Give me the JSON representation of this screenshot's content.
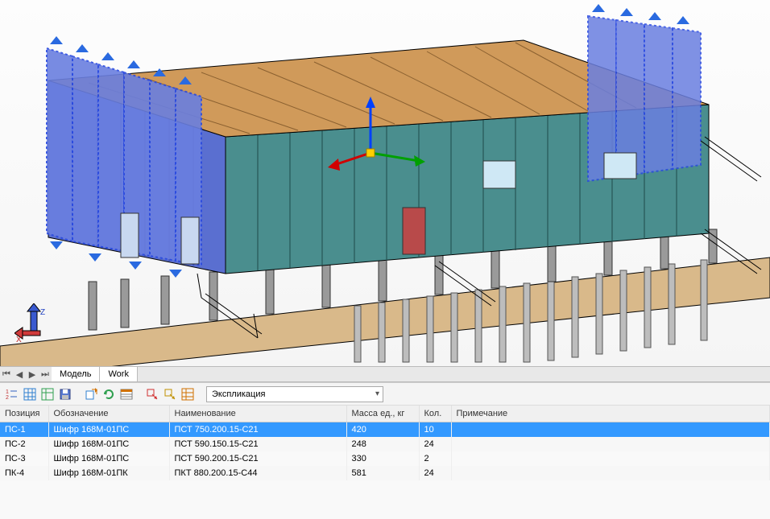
{
  "tabs": {
    "model": "Модель",
    "work": "Work"
  },
  "dropdown": {
    "value": "Экспликация"
  },
  "columns": {
    "pos": "Позиция",
    "des": "Обозначение",
    "name": "Наименование",
    "mass": "Масса ед., кг",
    "qty": "Кол.",
    "note": "Примечание"
  },
  "rows": [
    {
      "pos": "ПС-1",
      "des": "Шифр 168М-01ПС",
      "name": "ПСТ 750.200.15-С21",
      "mass": "420",
      "qty": "10",
      "note": "",
      "selected": true
    },
    {
      "pos": "ПС-2",
      "des": "Шифр 168М-01ПС",
      "name": "ПСТ 590.150.15-С21",
      "mass": "248",
      "qty": "24",
      "note": ""
    },
    {
      "pos": "ПС-3",
      "des": "Шифр 168М-01ПС",
      "name": "ПСТ 590.200.15-С21",
      "mass": "330",
      "qty": "2",
      "note": ""
    },
    {
      "pos": "ПК-4",
      "des": "Шифр 168М-01ПК",
      "name": "ПКТ 880.200.15-С44",
      "mass": "581",
      "qty": "24",
      "note": ""
    }
  ],
  "ucs": {
    "x": "X",
    "z": "Z"
  }
}
